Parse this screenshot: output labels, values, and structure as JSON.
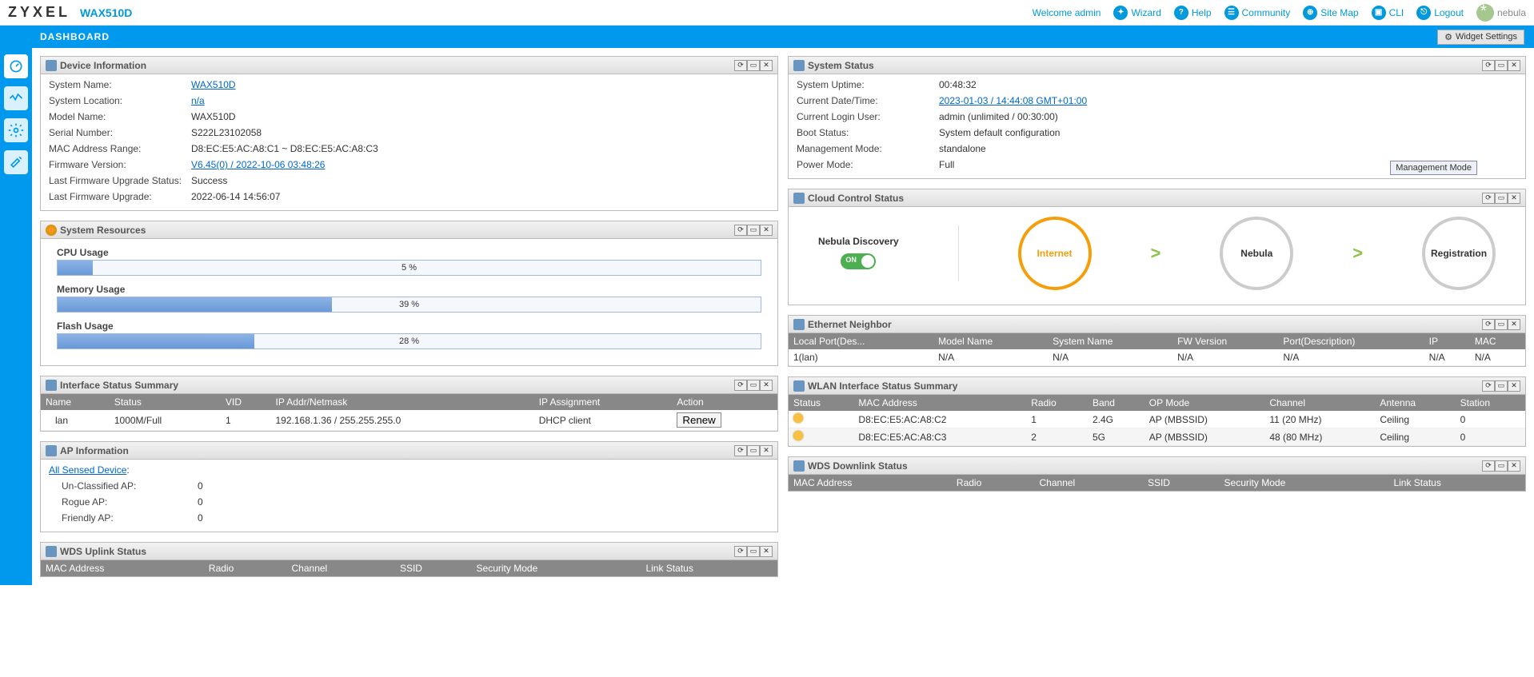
{
  "brand": "ZYXEL",
  "model": "WAX510D",
  "top": {
    "welcome": "Welcome admin",
    "wizard": "Wizard",
    "help": "Help",
    "community": "Community",
    "sitemap": "Site Map",
    "cli": "CLI",
    "logout": "Logout",
    "nebula": "nebula"
  },
  "dashboard": "DASHBOARD",
  "widget_settings": "Widget Settings",
  "devinfo": {
    "title": "Device Information",
    "system_name_k": "System Name:",
    "system_name_v": "WAX510D",
    "system_location_k": "System Location:",
    "system_location_v": "n/a",
    "model_name_k": "Model Name:",
    "model_name_v": "WAX510D",
    "serial_k": "Serial Number:",
    "serial_v": "S222L23102058",
    "mac_k": "MAC Address Range:",
    "mac_v": "D8:EC:E5:AC:A8:C1 ~ D8:EC:E5:AC:A8:C3",
    "fw_k": "Firmware Version:",
    "fw_v": "V6.45(0) / 2022-10-06 03:48:26",
    "upg_status_k": "Last Firmware Upgrade Status:",
    "upg_status_v": "Success",
    "upg_time_k": "Last Firmware Upgrade:",
    "upg_time_v": "2022-06-14 14:56:07"
  },
  "sysres": {
    "title": "System Resources",
    "cpu_label": "CPU Usage",
    "cpu_pct": "5 %",
    "cpu_width": "5%",
    "mem_label": "Memory Usage",
    "mem_pct": "39 %",
    "mem_width": "39%",
    "flash_label": "Flash Usage",
    "flash_pct": "28 %",
    "flash_width": "28%"
  },
  "ifsum": {
    "title": "Interface Status Summary",
    "cols": {
      "name": "Name",
      "status": "Status",
      "vid": "VID",
      "ip": "IP Addr/Netmask",
      "assign": "IP Assignment",
      "action": "Action"
    },
    "row": {
      "name": "lan",
      "status": "1000M/Full",
      "vid": "1",
      "ip": "192.168.1.36 / 255.255.255.0",
      "assign": "DHCP client",
      "renew": "Renew"
    }
  },
  "apinfo": {
    "title": "AP Information",
    "all_sensed": "All Sensed Device",
    "unclassified_k": "Un-Classified AP:",
    "unclassified_v": "0",
    "rogue_k": "Rogue AP:",
    "rogue_v": "0",
    "friendly_k": "Friendly AP:",
    "friendly_v": "0"
  },
  "wds_up": {
    "title": "WDS Uplink Status",
    "cols": {
      "mac": "MAC Address",
      "radio": "Radio",
      "channel": "Channel",
      "ssid": "SSID",
      "sec": "Security Mode",
      "link": "Link Status"
    }
  },
  "sysstat": {
    "title": "System Status",
    "uptime_k": "System Uptime:",
    "uptime_v": "00:48:32",
    "datetime_k": "Current Date/Time:",
    "datetime_v": "2023-01-03 / 14:44:08 GMT+01:00",
    "loginuser_k": "Current Login User:",
    "loginuser_v": "admin (unlimited / 00:30:00)",
    "boot_k": "Boot Status:",
    "boot_v": "System default configuration",
    "mgmt_k": "Management Mode:",
    "mgmt_v": "standalone",
    "power_k": "Power Mode:",
    "power_v": "Full",
    "mgmt_badge": "Management Mode"
  },
  "cloud": {
    "title": "Cloud Control Status",
    "nebula_discovery": "Nebula Discovery",
    "switch": "ON",
    "internet": "Internet",
    "nebula": "Nebula",
    "registration": "Registration"
  },
  "ethnbr": {
    "title": "Ethernet Neighbor",
    "cols": {
      "local": "Local Port(Des...",
      "model": "Model Name",
      "sys": "System Name",
      "fw": "FW Version",
      "port": "Port(Description)",
      "ip": "IP",
      "mac": "MAC"
    },
    "row": {
      "local": "1(lan)",
      "model": "N/A",
      "sys": "N/A",
      "fw": "N/A",
      "port": "N/A",
      "ip": "N/A",
      "mac": "N/A"
    }
  },
  "wlan": {
    "title": "WLAN Interface Status Summary",
    "cols": {
      "status": "Status",
      "mac": "MAC Address",
      "radio": "Radio",
      "band": "Band",
      "op": "OP Mode",
      "ch": "Channel",
      "ant": "Antenna",
      "sta": "Station"
    },
    "r1": {
      "mac": "D8:EC:E5:AC:A8:C2",
      "radio": "1",
      "band": "2.4G",
      "op": "AP (MBSSID)",
      "ch": "11 (20 MHz)",
      "ant": "Ceiling",
      "sta": "0"
    },
    "r2": {
      "mac": "D8:EC:E5:AC:A8:C3",
      "radio": "2",
      "band": "5G",
      "op": "AP (MBSSID)",
      "ch": "48 (80 MHz)",
      "ant": "Ceiling",
      "sta": "0"
    }
  },
  "wds_down": {
    "title": "WDS Downlink Status",
    "cols": {
      "mac": "MAC Address",
      "radio": "Radio",
      "channel": "Channel",
      "ssid": "SSID",
      "sec": "Security Mode",
      "link": "Link Status"
    }
  }
}
